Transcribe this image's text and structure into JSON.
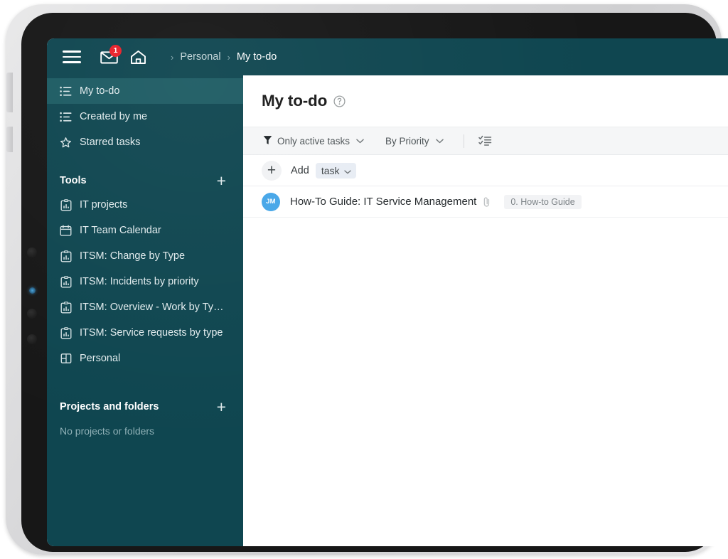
{
  "topbar": {
    "menu_icon": "hamburger-menu-icon",
    "mail_icon": "envelope-icon",
    "mail_badge_count": "1",
    "home_icon": "home-icon",
    "breadcrumb": {
      "separator": "›",
      "items": [
        {
          "label": "Personal",
          "current": false
        },
        {
          "label": "My to-do",
          "current": true
        }
      ]
    }
  },
  "sidebar": {
    "nav": [
      {
        "label": "My to-do",
        "icon": "list-icon",
        "active": true
      },
      {
        "label": "Created by me",
        "icon": "list-icon",
        "active": false
      },
      {
        "label": "Starred tasks",
        "icon": "star-icon",
        "active": false
      }
    ],
    "tools_section": {
      "title": "Tools",
      "add_icon": "plus-icon",
      "items": [
        {
          "label": "IT projects",
          "icon": "clipboard-chart-icon"
        },
        {
          "label": "IT Team Calendar",
          "icon": "calendar-icon"
        },
        {
          "label": "ITSM: Change by Type",
          "icon": "clipboard-chart-icon"
        },
        {
          "label": "ITSM: Incidents by priority",
          "icon": "clipboard-chart-icon"
        },
        {
          "label": "ITSM: Overview - Work by Ty…",
          "icon": "clipboard-chart-icon"
        },
        {
          "label": "ITSM: Service requests by type",
          "icon": "clipboard-chart-icon"
        },
        {
          "label": "Personal",
          "icon": "layout-panels-icon"
        }
      ]
    },
    "projects_section": {
      "title": "Projects and folders",
      "add_icon": "plus-icon",
      "empty_text": "No projects or folders"
    }
  },
  "main": {
    "page_title": "My to-do",
    "help_icon": "question-circle-icon",
    "filterbar": {
      "filter_icon": "funnel-icon",
      "filter_label": "Only active tasks",
      "sort_label": "By Priority",
      "chevron_icon": "chevron-down-icon",
      "view_icon": "checklist-view-icon"
    },
    "add_row": {
      "plus_icon": "plus-icon",
      "add_label": "Add",
      "type_label": "task",
      "type_chevron_icon": "chevron-down-icon"
    },
    "tasks": [
      {
        "avatar_initials": "JM",
        "avatar_color": "#45a6e8",
        "name": "How-To Guide: IT Service Management",
        "attachment_icon": "paperclip-icon",
        "tag": "0. How-to Guide"
      }
    ]
  },
  "colors": {
    "sidebar_bg": "#0f4650",
    "sidebar_active": "#1d5b63",
    "badge_red": "#e8202a",
    "filterbar_bg": "#f5f6f7",
    "avatar_blue": "#45a6e8"
  }
}
